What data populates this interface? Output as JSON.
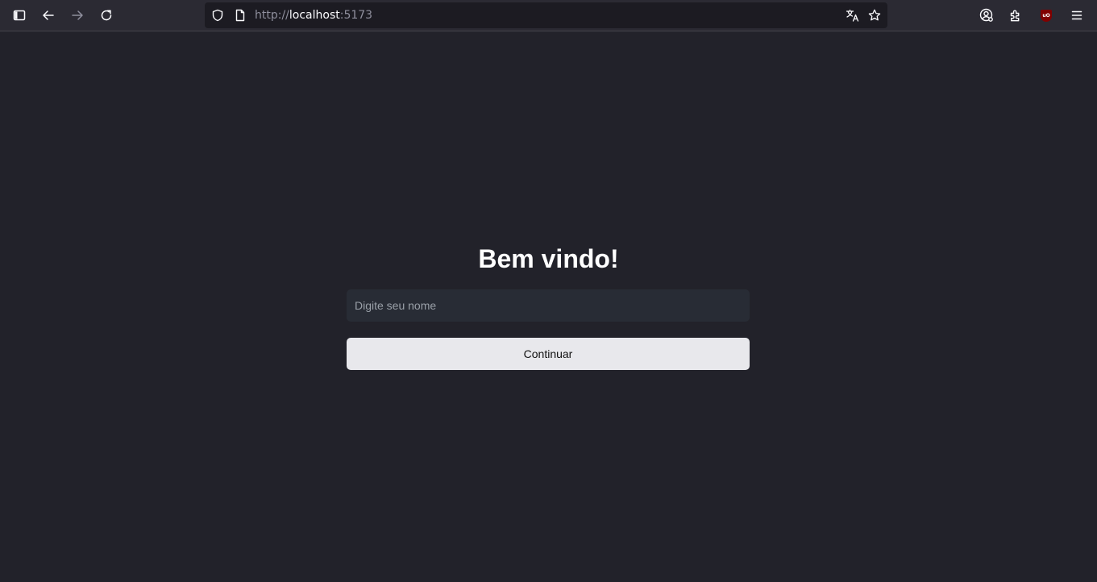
{
  "browser": {
    "url": {
      "scheme": "http://",
      "host": "localhost",
      "port": ":5173"
    },
    "toolbar_icons": [
      "sidebar-icon",
      "back-arrow-icon",
      "forward-arrow-icon",
      "reload-icon",
      "shield-icon",
      "page-icon",
      "translate-icon",
      "bookmark-star-icon",
      "account-icon",
      "extensions-icon",
      "ublock-origin-icon",
      "menu-icon"
    ],
    "ublock_label": "uO"
  },
  "page": {
    "title": "Bem vindo!",
    "name_input": {
      "placeholder": "Digite seu nome",
      "value": ""
    },
    "continue_label": "Continuar"
  },
  "colors": {
    "page_background": "#22222a",
    "chrome_background": "#2b2a33",
    "urlbar_background": "#1c1b22",
    "input_background": "#282c35",
    "button_background": "#e8e8ec",
    "ublock_red": "#800000"
  }
}
